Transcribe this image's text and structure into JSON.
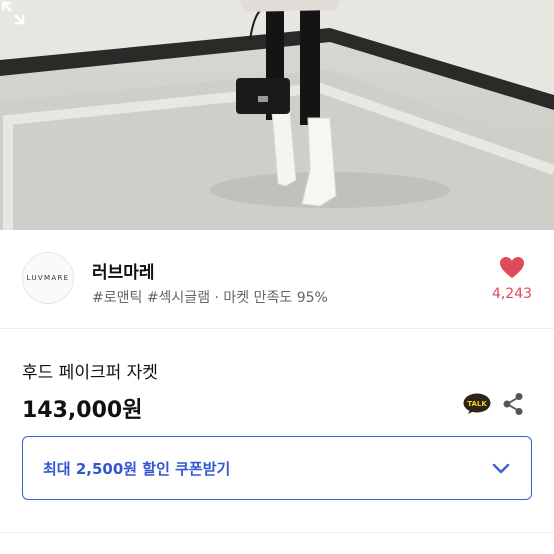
{
  "shop": {
    "logo_text": "LUVMARE",
    "name": "러브마레",
    "tags": "#로맨틱 #섹시글램 · 마켓 만족도 95%",
    "like_count": "4,243"
  },
  "product": {
    "name": "후드 페이크퍼 자켓",
    "price": "143,000원"
  },
  "actions": {
    "talk_label": "TALK"
  },
  "coupon": {
    "label": "최대 2,500원 할인 쿠폰받기"
  },
  "icons": {
    "expand": "expand-icon",
    "heart": "heart-icon",
    "talk": "kakao-talk-icon",
    "share": "share-icon",
    "chevron": "chevron-down-icon"
  },
  "colors": {
    "accent": "#3d5fd6",
    "like": "#e04a5a"
  }
}
